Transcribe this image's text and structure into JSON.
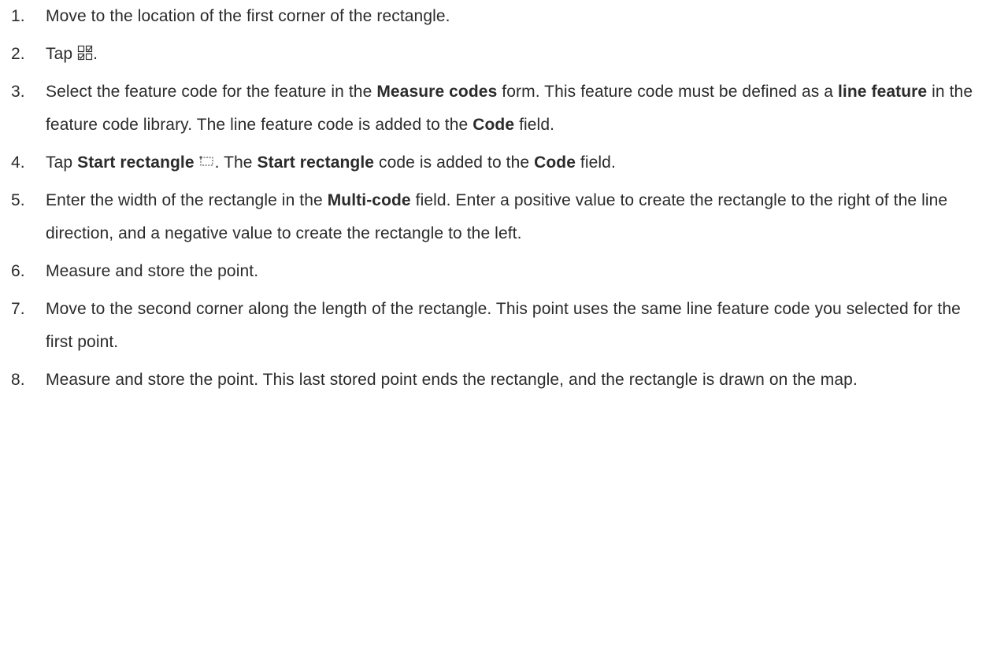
{
  "steps": [
    {
      "number": "1.",
      "segments": [
        {
          "text": "Move to the location of the first corner of the rectangle."
        }
      ]
    },
    {
      "number": "2.",
      "segments": [
        {
          "text": "Tap "
        },
        {
          "icon": "measure-codes-icon"
        },
        {
          "text": "."
        }
      ]
    },
    {
      "number": "3.",
      "segments": [
        {
          "text": "Select the feature code for the feature in the "
        },
        {
          "text": "Measure codes",
          "bold": true
        },
        {
          "text": " form. This feature code must be defined as a "
        },
        {
          "text": "line feature",
          "bold": true
        },
        {
          "text": " in the feature code library. The line feature code is added to the "
        },
        {
          "text": "Code",
          "bold": true
        },
        {
          "text": " field."
        }
      ]
    },
    {
      "number": "4.",
      "segments": [
        {
          "text": "Tap "
        },
        {
          "text": "Start rectangle",
          "bold": true
        },
        {
          "text": " "
        },
        {
          "icon": "start-rectangle-icon"
        },
        {
          "text": ". The "
        },
        {
          "text": "Start rectangle",
          "bold": true
        },
        {
          "text": " code is added to the "
        },
        {
          "text": "Code",
          "bold": true
        },
        {
          "text": " field."
        }
      ]
    },
    {
      "number": "5.",
      "segments": [
        {
          "text": "Enter the width of the rectangle in the "
        },
        {
          "text": "Multi-code",
          "bold": true
        },
        {
          "text": " field. Enter a positive value to create the rectangle to the right of the line direction, and a negative value to create the rectangle to the left."
        }
      ]
    },
    {
      "number": "6.",
      "segments": [
        {
          "text": "Measure and store the point."
        }
      ]
    },
    {
      "number": "7.",
      "segments": [
        {
          "text": "Move to the second corner along the length of the rectangle. This point uses the same line feature code you selected for the first point."
        }
      ]
    },
    {
      "number": "8.",
      "segments": [
        {
          "text": "Measure and store the point. This last stored point ends the rectangle, and the rectangle is drawn on the map."
        }
      ]
    }
  ]
}
